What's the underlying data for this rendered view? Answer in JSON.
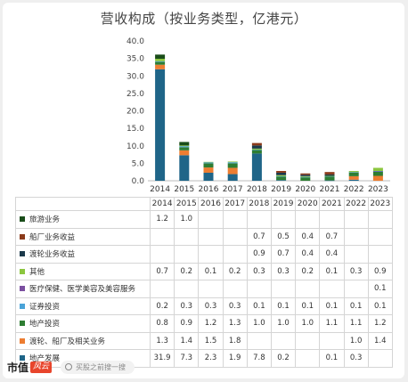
{
  "chart_data": {
    "type": "bar",
    "stacked": true,
    "title": "营收构成（按业务类型，亿港元）",
    "categories": [
      "2014",
      "2015",
      "2016",
      "2017",
      "2018",
      "2019",
      "2020",
      "2021",
      "2022",
      "2023"
    ],
    "ylim": [
      0,
      40
    ],
    "yticks": [
      "0.0",
      "5.0",
      "10.0",
      "15.0",
      "20.0",
      "25.0",
      "30.0",
      "35.0",
      "40.0"
    ],
    "series": [
      {
        "name": "地产发展",
        "color": "#1f6588",
        "values": [
          31.9,
          7.3,
          2.3,
          1.9,
          7.8,
          0.2,
          null,
          0.1,
          0.3,
          null
        ],
        "labels": [
          "31.9",
          "7.3",
          "2.3",
          "1.9",
          "7.8",
          "0.2",
          "",
          "0.1",
          "0.3",
          ""
        ]
      },
      {
        "name": "渡轮、船厂及相关业务",
        "color": "#ed7d31",
        "values": [
          1.3,
          1.4,
          1.5,
          1.8,
          null,
          null,
          null,
          null,
          1.0,
          1.4
        ],
        "labels": [
          "1.3",
          "1.4",
          "1.5",
          "1.8",
          "",
          "",
          "",
          "",
          "1.0",
          "1.4"
        ]
      },
      {
        "name": "地产投资",
        "color": "#2e7d32",
        "values": [
          0.8,
          0.9,
          1.2,
          1.3,
          1.0,
          1.0,
          1.0,
          1.1,
          1.1,
          1.2
        ],
        "labels": [
          "0.8",
          "0.9",
          "1.2",
          "1.3",
          "1.0",
          "1.0",
          "1.0",
          "1.1",
          "1.1",
          "1.2"
        ]
      },
      {
        "name": "证券投资",
        "color": "#4aa3d8",
        "values": [
          0.2,
          0.3,
          0.3,
          0.3,
          0.1,
          0.1,
          0.1,
          0.1,
          0.1,
          0.1
        ],
        "labels": [
          "0.2",
          "0.3",
          "0.3",
          "0.3",
          "0.1",
          "0.1",
          "0.1",
          "0.1",
          "0.1",
          "0.1"
        ]
      },
      {
        "name": "医疗保健、医学美容及美容服务",
        "color": "#7b4fa0",
        "values": [
          null,
          null,
          null,
          null,
          null,
          null,
          null,
          null,
          null,
          0.1
        ],
        "labels": [
          "",
          "",
          "",
          "",
          "",
          "",
          "",
          "",
          "",
          "0.1"
        ]
      },
      {
        "name": "其他",
        "color": "#8cc63f",
        "values": [
          0.7,
          0.2,
          0.1,
          0.2,
          0.3,
          0.3,
          0.2,
          0.1,
          0.3,
          0.9
        ],
        "labels": [
          "0.7",
          "0.2",
          "0.1",
          "0.2",
          "0.3",
          "0.3",
          "0.2",
          "0.1",
          "0.3",
          "0.9"
        ]
      },
      {
        "name": "渡轮业务收益",
        "color": "#1b3a4b",
        "values": [
          null,
          null,
          null,
          null,
          0.9,
          0.7,
          0.4,
          0.4,
          null,
          null
        ],
        "labels": [
          "",
          "",
          "",
          "",
          "0.9",
          "0.7",
          "0.4",
          "0.4",
          "",
          ""
        ]
      },
      {
        "name": "船厂业务收益",
        "color": "#8b3a1a",
        "values": [
          null,
          null,
          null,
          null,
          0.7,
          0.5,
          0.4,
          0.7,
          null,
          null
        ],
        "labels": [
          "",
          "",
          "",
          "",
          "0.7",
          "0.5",
          "0.4",
          "0.7",
          "",
          ""
        ]
      },
      {
        "name": "旅游业务",
        "color": "#1a4d1a",
        "values": [
          1.2,
          1.0,
          null,
          null,
          null,
          null,
          null,
          null,
          null,
          null
        ],
        "labels": [
          "1.2",
          "1.0",
          "",
          "",
          "",
          "",
          "",
          "",
          "",
          ""
        ]
      }
    ],
    "table_row_order": [
      "旅游业务",
      "船厂业务收益",
      "渡轮业务收益",
      "其他",
      "医疗保健、医学美容及美容服务",
      "证券投资",
      "地产投资",
      "渡轮、船厂及相关业务",
      "地产发展"
    ]
  },
  "footer": {
    "brand": "市值",
    "brand_badge": "风云",
    "search_placeholder": "买股之前搜一搜"
  }
}
